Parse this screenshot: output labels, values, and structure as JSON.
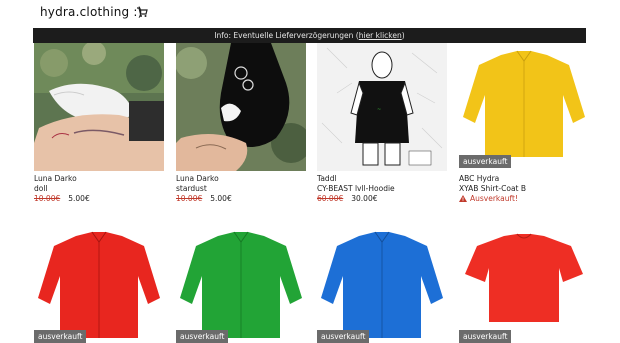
{
  "header": {
    "brand": "hydra.clothing :)",
    "cart_icon": "cart-icon"
  },
  "infobar": {
    "text": "Info: Eventuelle Lieferverzögerungen (",
    "link": "hier klicken",
    "close": ")"
  },
  "products_row1": [
    {
      "brand": "Luna Darko",
      "name": "doll",
      "old_price": "10.00€",
      "price": "5.00€"
    },
    {
      "brand": "Luna Darko",
      "name": "stardust",
      "old_price": "10.00€",
      "price": "5.00€"
    },
    {
      "brand": "Taddl",
      "name": "CY-BEAST lvll-Hoodie",
      "old_price": "60.00€",
      "price": "30.00€"
    },
    {
      "brand": "ABC Hydra",
      "name": "XYAB Shirt-Coat B",
      "badge": "ausverkauft",
      "soldout": "Ausverkauft!"
    }
  ],
  "products_row2": [
    {
      "badge": "ausverkauft",
      "color": "#e8261f"
    },
    {
      "badge": "ausverkauft",
      "color": "#22a436"
    },
    {
      "badge": "ausverkauft",
      "color": "#1d6fd6"
    },
    {
      "badge": "ausverkauft",
      "color": "#ee2e24"
    }
  ],
  "colors": {
    "yellow_jacket": "#f2c418",
    "sale_red": "#c0392b",
    "infobar_bg": "#1c1c1c",
    "badge_bg": "#6b6b6b"
  }
}
